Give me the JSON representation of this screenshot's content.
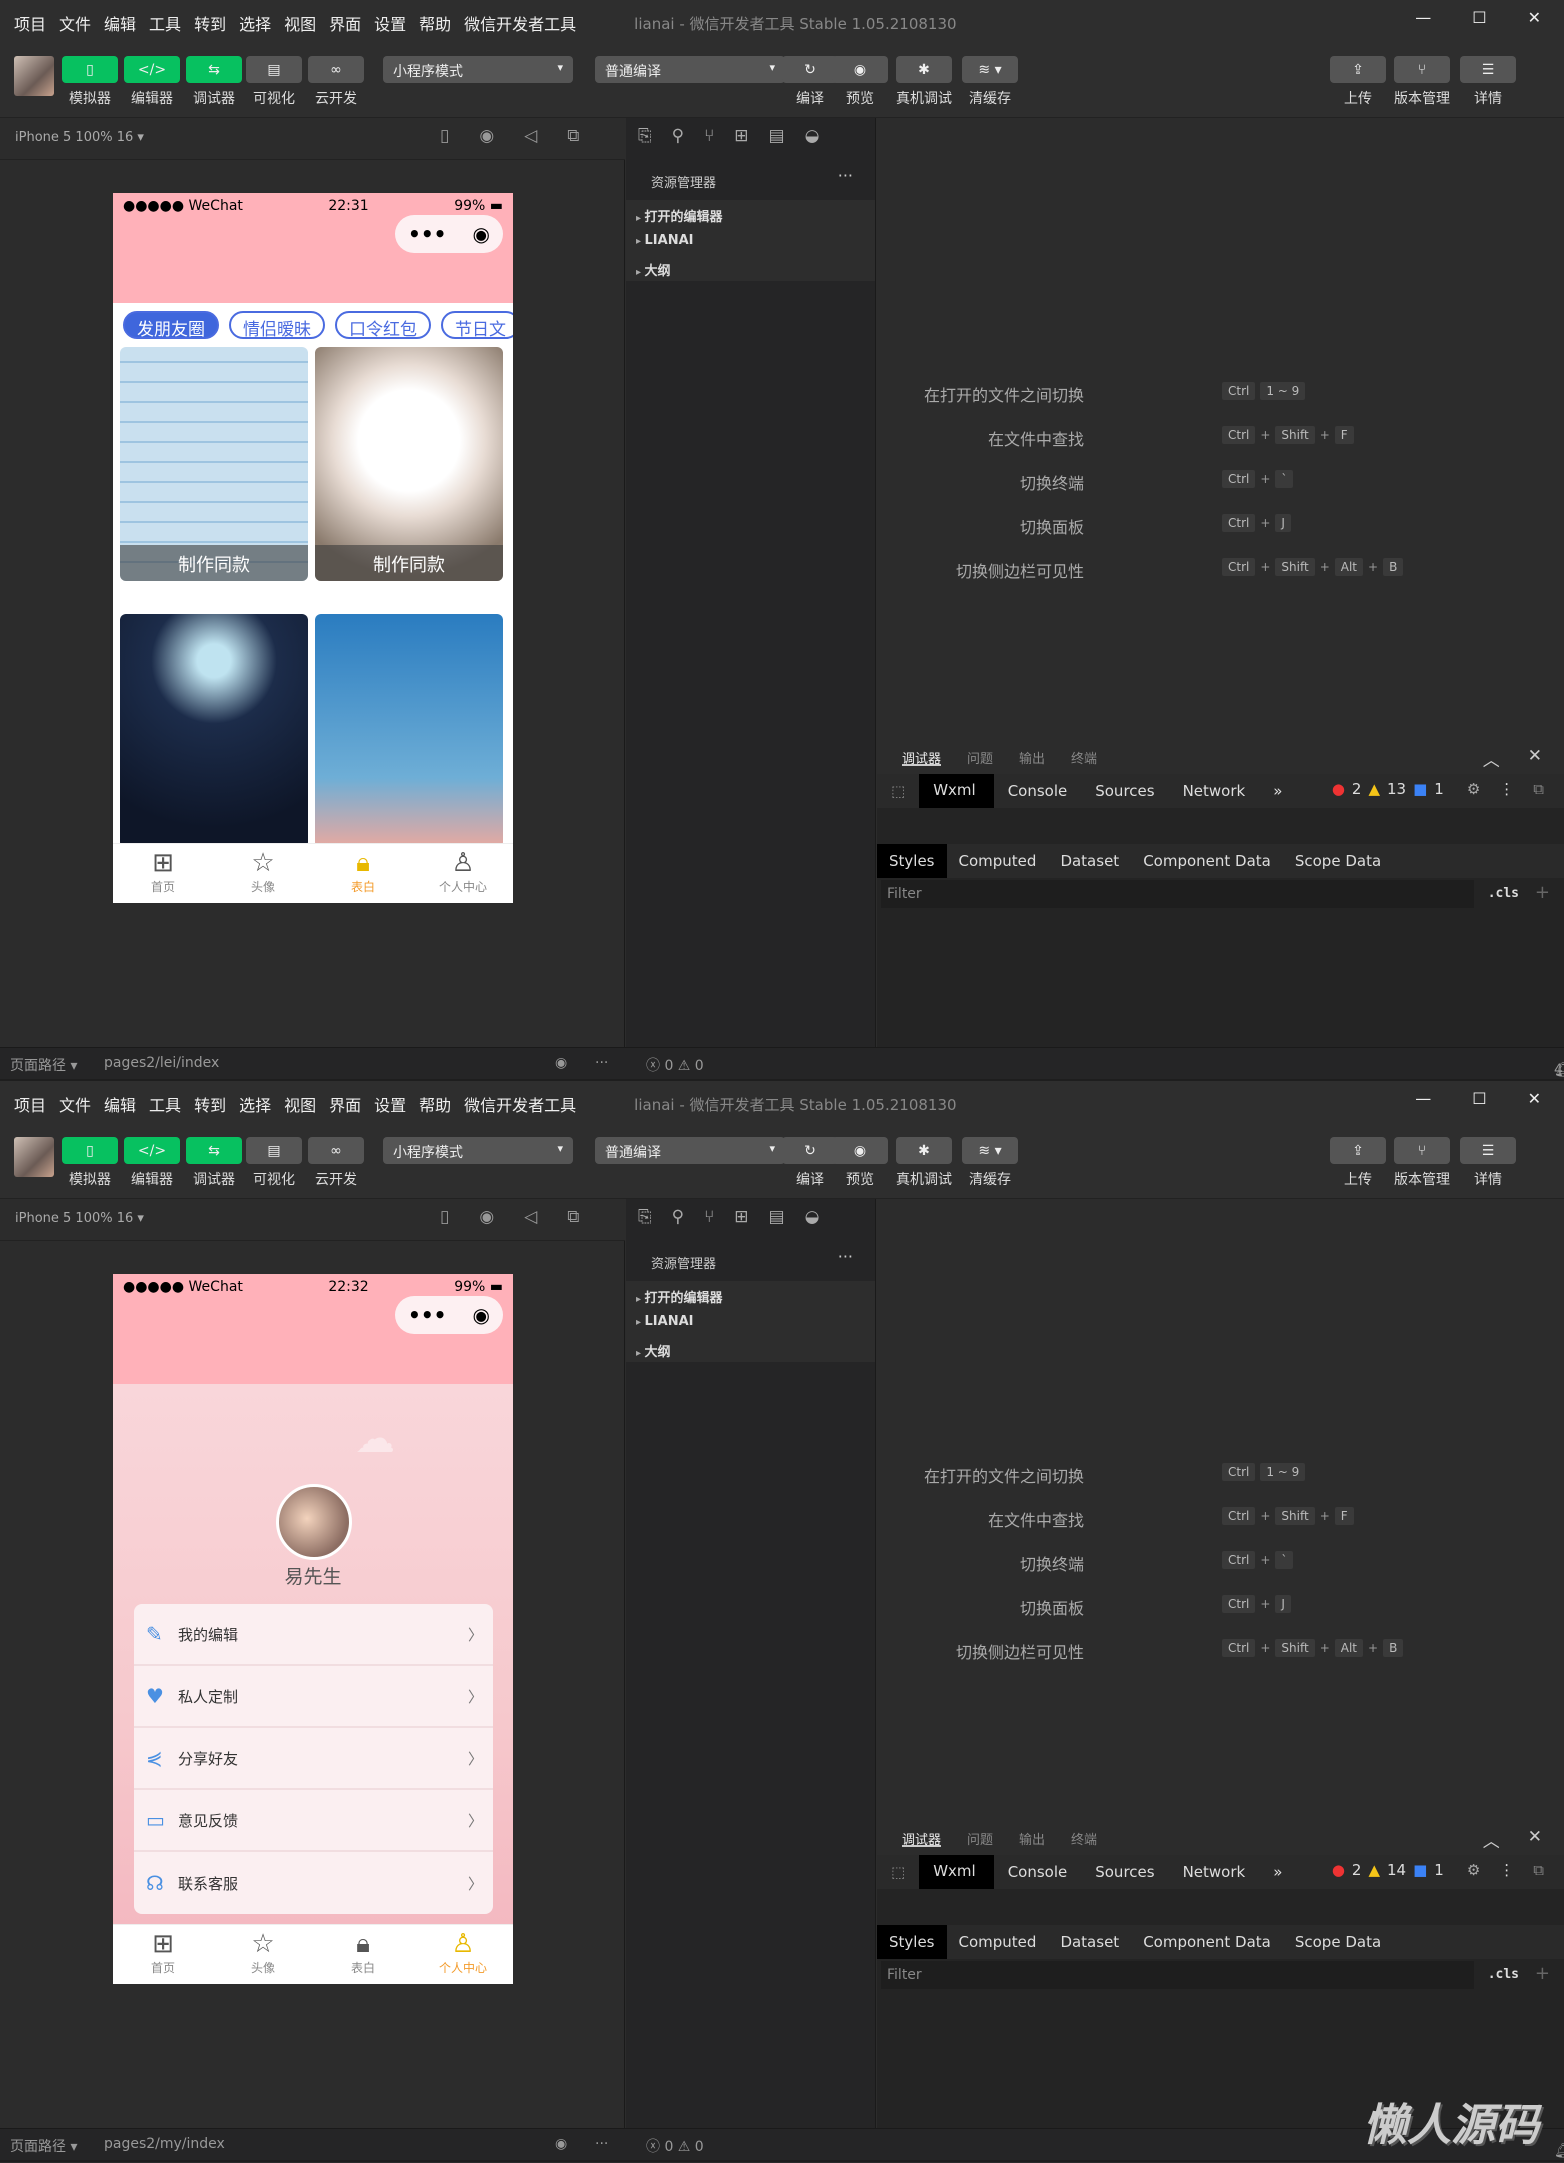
{
  "app": {
    "menu": [
      "项目",
      "文件",
      "编辑",
      "工具",
      "转到",
      "选择",
      "视图",
      "界面",
      "设置",
      "帮助",
      "微信开发者工具"
    ],
    "title": "lianai - 微信开发者工具 Stable 1.05.2108130",
    "left_tools": [
      "模拟器",
      "编辑器",
      "调试器",
      "可视化",
      "云开发"
    ],
    "mode_select": "小程序模式",
    "compile_select": "普通编译",
    "mid_tools": [
      "编译",
      "预览",
      "真机调试",
      "清缓存"
    ],
    "right_tools": [
      "上传",
      "版本管理",
      "详情"
    ],
    "device": "iPhone 5 100% 16 ▾",
    "explorer_title": "资源管理器",
    "explorer_items": [
      "打开的编辑器",
      "LIANAI",
      "大纲"
    ],
    "shortcuts": [
      {
        "label": "在打开的文件之间切换",
        "keys": [
          "Ctrl",
          "1 ~ 9"
        ]
      },
      {
        "label": "在文件中查找",
        "keys": [
          "Ctrl",
          "+",
          "Shift",
          "+",
          "F"
        ]
      },
      {
        "label": "切换终端",
        "keys": [
          "Ctrl",
          "+",
          "`"
        ]
      },
      {
        "label": "切换面板",
        "keys": [
          "Ctrl",
          "+",
          "J"
        ]
      },
      {
        "label": "切换侧边栏可见性",
        "keys": [
          "Ctrl",
          "+",
          "Shift",
          "+",
          "Alt",
          "+",
          "B"
        ]
      }
    ],
    "debug_tabs": [
      "调试器",
      "问题",
      "输出",
      "终端"
    ],
    "devtools_tabs": [
      "Wxml",
      "Console",
      "Sources",
      "Network",
      "»"
    ],
    "style_tabs": [
      "Styles",
      "Computed",
      "Dataset",
      "Component Data",
      "Scope Data"
    ],
    "filter_placeholder": "Filter",
    "cls": ".cls",
    "path_label": "页面路径 ▾",
    "status_counts": "ⓧ 0 ⚠ 0",
    "tabbar": [
      "首页",
      "头像",
      "表白",
      "个人中心"
    ],
    "carrier": "●●●●● WeChat",
    "battery": "99%",
    "errors": "2",
    "infos": "1",
    "colors": {
      "green": "#07c160",
      "pink": "#ffb1b9",
      "blue": "#3f66dc",
      "active": "#f39b2b"
    }
  },
  "windows": [
    {
      "time": "22:31",
      "warnings": "13",
      "path": "pages2/lei/index",
      "notifications": "4",
      "tabs": [
        "发朋友圈",
        "情侣暧昧",
        "口令红包",
        "节日文"
      ],
      "card_caption": "制作同款",
      "active_tab": 2
    },
    {
      "time": "22:32",
      "warnings": "14",
      "path": "pages2/my/index",
      "username": "易先生",
      "menu": [
        "我的编辑",
        "私人定制",
        "分享好友",
        "意见反馈",
        "联系客服"
      ],
      "active_tab": 3
    }
  ],
  "watermark": "懒人源码"
}
